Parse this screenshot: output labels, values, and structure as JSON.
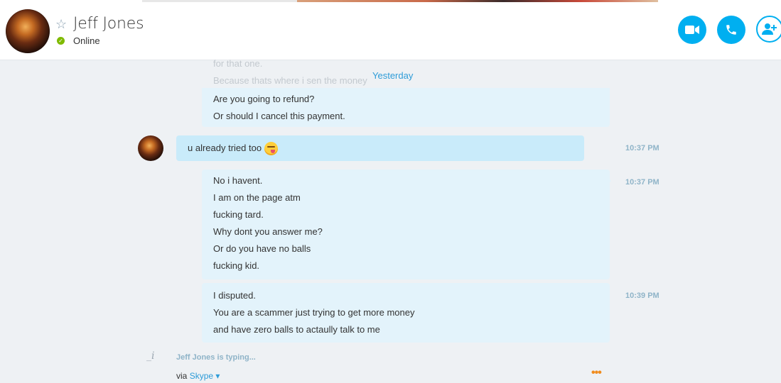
{
  "header": {
    "contact_name": "Jeff Jones",
    "status": "Online",
    "star_icon": "star-outline-icon",
    "buttons": {
      "video": "video-call-icon",
      "call": "phone-icon",
      "add": "add-contact-icon"
    }
  },
  "chat": {
    "faded_lines": [
      "for that one.",
      "Because thats where i sen the money"
    ],
    "date_separator": "Yesterday",
    "messages": [
      {
        "sender": "me",
        "lines": [
          "Are you going to refund?",
          "Or should I cancel this payment."
        ],
        "time": ""
      },
      {
        "sender": "Jeff Jones",
        "lines": [
          "u already tried too"
        ],
        "emoji": "tongue-out-emoji",
        "time": "10:37 PM"
      },
      {
        "sender": "me",
        "lines": [
          "No i havent.",
          "I am on the page atm",
          "fucking tard.",
          "Why dont you answer me?",
          "Or do you have no balls",
          "fucking kid."
        ],
        "time": "10:37 PM"
      },
      {
        "sender": "me",
        "lines": [
          "I disputed.",
          "You are a scammer just trying to get more money",
          "and have zero balls to actaully talk to me"
        ],
        "time": "10:39 PM"
      }
    ],
    "typing_indicator": "Jeff Jones is typing...",
    "via_label": "via",
    "via_link": "Skype",
    "via_caret": "▾",
    "more_label": "•••"
  },
  "colors": {
    "accent": "#00aff0",
    "link": "#2e9cd8",
    "online": "#7fba00",
    "bubble_mine": "#e3f3fb",
    "bubble_theirs": "#c9ebfa",
    "more": "#f08c1e"
  }
}
